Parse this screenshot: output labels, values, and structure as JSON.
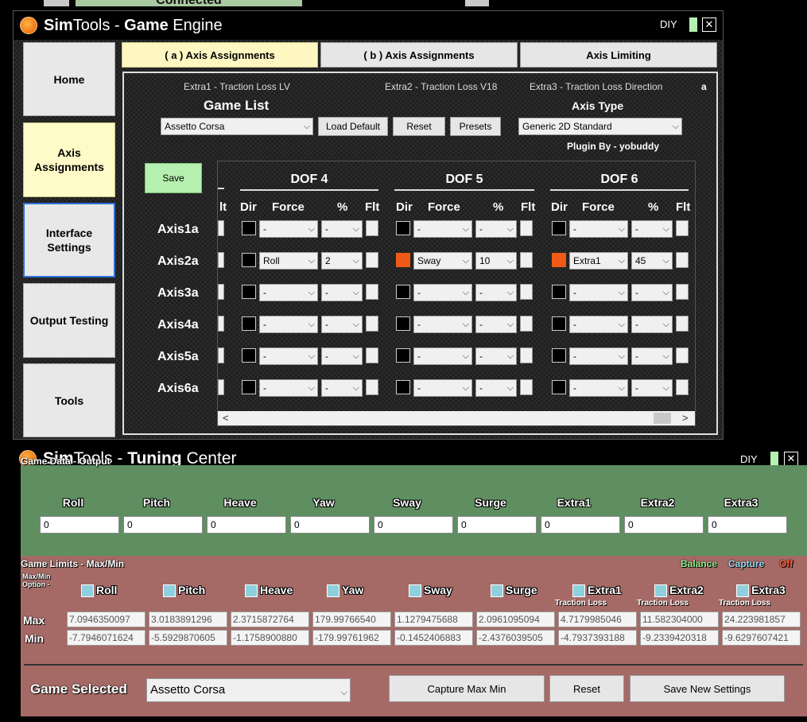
{
  "top_strip": {
    "status": "Connected"
  },
  "game_engine": {
    "title_prefix": "Sim",
    "title_mid": "Tools - ",
    "title_bold": "Game",
    "title_suffix": " Engine",
    "diy": "DIY",
    "close": "✕",
    "sidebar": [
      "Home",
      "Axis Assignments",
      "Interface Settings",
      "Output Testing",
      "Tools"
    ],
    "tabs": [
      "( a ) Axis Assignments",
      "( b ) Axis Assignments",
      "Axis Limiting"
    ],
    "extras": [
      "Extra1 - Traction Loss LV",
      "Extra2 - Traction Loss V18",
      "Extra3 - Traction Loss Direction"
    ],
    "extras_tail": "a",
    "game_list_label": "Game List",
    "game_value": "Assetto Corsa",
    "buttons": {
      "load_default": "Load Default",
      "reset": "Reset",
      "presets": "Presets",
      "save": "Save"
    },
    "axis_type_label": "Axis Type",
    "axis_type_value": "Generic 2D Standard",
    "plugin_by": "Plugin By - yobuddy",
    "dof_headers": [
      "DOF 4",
      "DOF 5",
      "DOF 6"
    ],
    "col_headers": {
      "prev": "lt",
      "dir": "Dir",
      "force": "Force",
      "pct": "%",
      "flt": "Flt"
    },
    "axes": [
      "Axis1a",
      "Axis2a",
      "Axis3a",
      "Axis4a",
      "Axis5a",
      "Axis6a"
    ],
    "grid_default": "-",
    "row2": {
      "dof4_force": "Roll",
      "dof4_pct": "2",
      "dof5_force": "Sway",
      "dof5_pct": "10",
      "dof6_force": "Extra1",
      "dof6_pct": "45"
    },
    "scroll_left": "<",
    "scroll_right": ">"
  },
  "tuning_center": {
    "title_prefix": "Sim",
    "title_mid": "Tools - ",
    "title_bold": "Tuning",
    "title_suffix": " Center",
    "diy": "DIY",
    "close": "✕",
    "game_data_label": "Game Data - Output",
    "channels": [
      "Roll",
      "Pitch",
      "Heave",
      "Yaw",
      "Sway",
      "Surge",
      "Extra1",
      "Extra2",
      "Extra3"
    ],
    "outputs": [
      "0",
      "0",
      "0",
      "0",
      "0",
      "0",
      "0",
      "0",
      "0"
    ],
    "game_limits_label": "Game Limits - Max/Min",
    "balance": "Balance",
    "capture": "Capture",
    "off": "Off",
    "maxmin_option_1": "Max/Min",
    "maxmin_option_2": "Option -",
    "traction_loss": "Traction Loss",
    "max_label": "Max",
    "min_label": "Min",
    "max_values": [
      "7.0946350097",
      "3.0183891296",
      "2.3715872764",
      "179.99766540",
      "1.1279475688",
      "2.0961095094",
      "4.7179985046",
      "11.582304000",
      "24.223981857"
    ],
    "min_values": [
      "-7.7946071624",
      "-5.5929870605",
      "-1.1758900880",
      "-179.99761962",
      "-0.1452406883",
      "-2.4376039505",
      "-4.7937393188",
      "-9.2339420318",
      "-9.6297607421"
    ],
    "game_selected_label": "Game Selected",
    "game_selected_value": "Assetto Corsa",
    "capture_btn": "Capture Max Min",
    "reset_btn": "Reset",
    "save_btn": "Save New Settings"
  }
}
